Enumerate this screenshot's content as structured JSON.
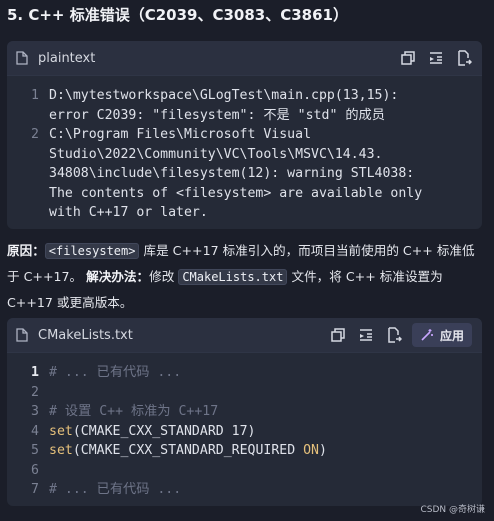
{
  "heading": "5. C++ 标准错误（C2039、C3083、C3861）",
  "block1": {
    "lang": "plaintext",
    "lines": [
      {
        "num": "1",
        "lines": [
          "D:\\mytestworkspace\\GLogTest\\main.cpp(13,15):",
          "error C2039: \"filesystem\": 不是 \"std\" 的成员"
        ]
      },
      {
        "num": "2",
        "lines": [
          "C:\\Program Files\\Microsoft Visual",
          "Studio\\2022\\Community\\VC\\Tools\\MSVC\\14.43.",
          "34808\\include\\filesystem(12): warning STL4038:",
          "The contents of <filesystem> are available only",
          "with C++17 or later."
        ]
      }
    ]
  },
  "explanation": {
    "cause_label": "原因",
    "colon": "：",
    "cause_code": "<filesystem>",
    "cause_text_1": " 库是 C++17 标准引入的，而项目当前使用的 C++ 标准低于 C++17。",
    "fix_label": "解决办法",
    "fix_text_1": "修改 ",
    "fix_code": "CMakeLists.txt",
    "fix_text_2": " 文件，将 C++ 标准设置为 C++17 或更高版本。"
  },
  "block2": {
    "filename": "CMakeLists.txt",
    "apply_label": "应用",
    "lines": [
      {
        "num": "1",
        "text": "# ... 已有代码 ...",
        "kind": "comment"
      },
      {
        "num": "2",
        "text": "",
        "kind": "blank"
      },
      {
        "num": "3",
        "text": "# 设置 C++ 标准为 C++17",
        "kind": "comment"
      },
      {
        "num": "4",
        "fn": "set",
        "open": "(",
        "args": "CMAKE_CXX_STANDARD 17",
        "close": ")",
        "kind": "call"
      },
      {
        "num": "5",
        "fn": "set",
        "open": "(",
        "args": "CMAKE_CXX_STANDARD_REQUIRED ",
        "kw": "ON",
        "close": ")",
        "kind": "call-kw"
      },
      {
        "num": "6",
        "text": "",
        "kind": "blank"
      },
      {
        "num": "7",
        "text": "# ... 已有代码 ...",
        "kind": "comment"
      }
    ]
  },
  "watermark": "CSDN @奇树谦",
  "icons": [
    "file-icon",
    "copy-icon",
    "insert-icon",
    "export-icon",
    "apply-icon"
  ],
  "colors": {
    "background": "#1b1e29",
    "block": "#252a37",
    "header": "#2b3040",
    "function": "#e5c07b",
    "comment": "#6e7488"
  }
}
